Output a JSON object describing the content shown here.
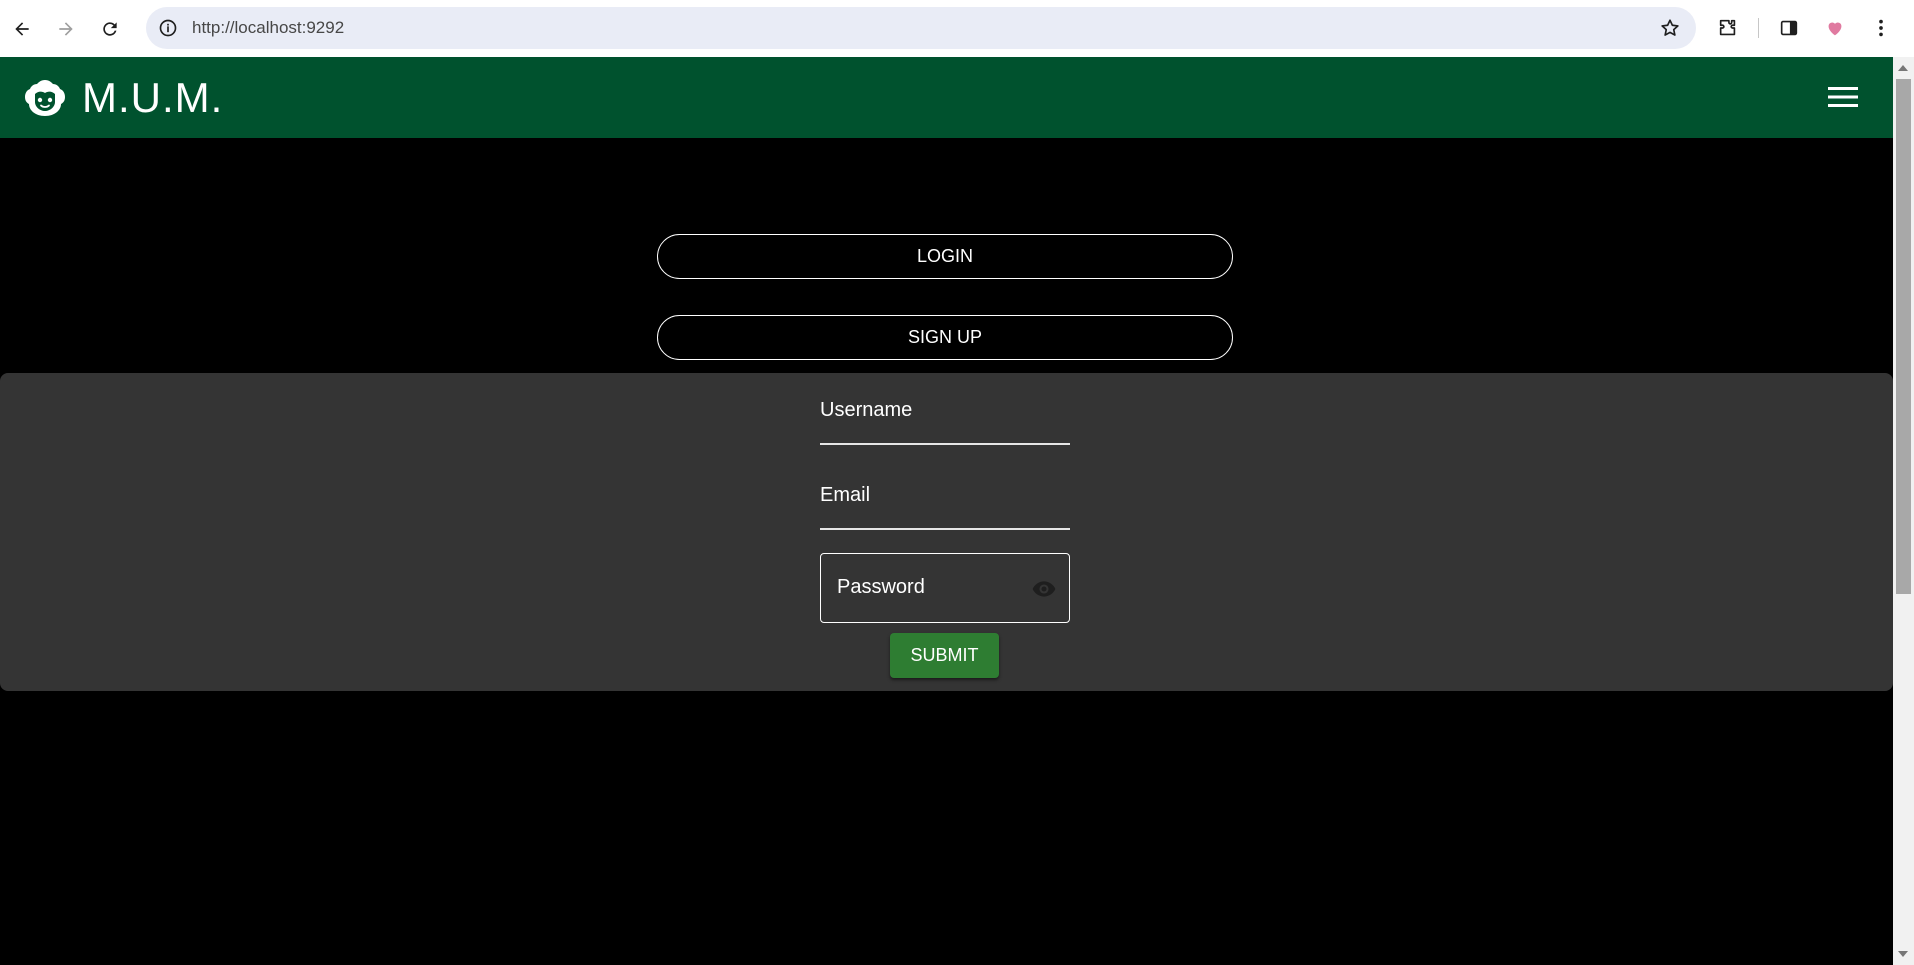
{
  "browser": {
    "url": "http://localhost:9292"
  },
  "header": {
    "title": "M.U.M.",
    "logo_icon": "face-icon",
    "menu_icon": "hamburger-menu-icon",
    "color": "#00522e"
  },
  "auth": {
    "login_label": "LOGIN",
    "signup_label": "SIGN UP"
  },
  "form": {
    "username_label": "Username",
    "email_label": "Email",
    "password_label": "Password",
    "submit_label": "SUBMIT",
    "submit_color": "#2e7d32",
    "panel_color": "#343434"
  }
}
